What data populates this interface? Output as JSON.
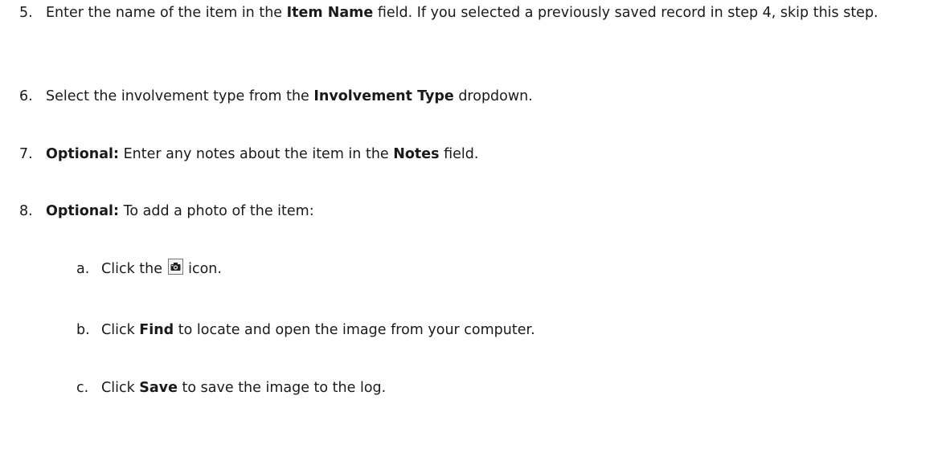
{
  "steps": [
    {
      "num": "5.",
      "parts": [
        "Enter the name of the item in the ",
        "Item Name",
        " field. If you selected a previously saved record in step 4, skip this step."
      ]
    },
    {
      "num": "6.",
      "parts": [
        "Select the involvement type from the ",
        "Involvement Type",
        " dropdown."
      ]
    },
    {
      "num": "7.",
      "parts": [
        "Optional:",
        " Enter any notes about the item in the ",
        "Notes",
        " field."
      ]
    },
    {
      "num": "8.",
      "parts": [
        "Optional:",
        " To add a photo of the item:"
      ]
    }
  ],
  "substeps": [
    {
      "num": "a.",
      "parts": [
        "Click the ",
        " icon."
      ],
      "icon": "camera-icon"
    },
    {
      "num": "b.",
      "parts": [
        "Click ",
        "Find",
        " to locate and open the image from your computer."
      ]
    },
    {
      "num": "c.",
      "parts": [
        "Click ",
        "Save",
        " to save the image to the log."
      ]
    }
  ]
}
